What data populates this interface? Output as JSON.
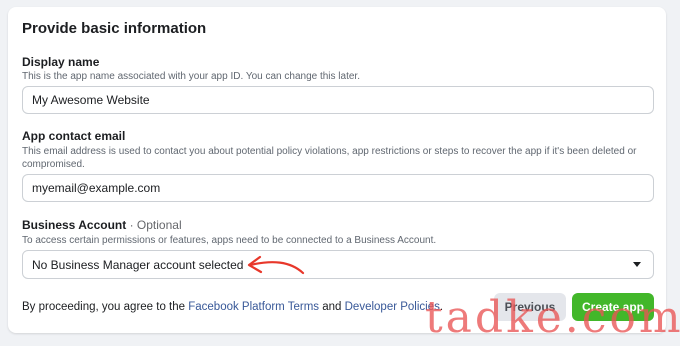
{
  "form": {
    "title": "Provide basic information",
    "display_name": {
      "label": "Display name",
      "help": "This is the app name associated with your app ID. You can change this later.",
      "value": "My Awesome Website"
    },
    "contact_email": {
      "label": "App contact email",
      "help": "This email address is used to contact you about potential policy violations, app restrictions or steps to recover the app if it's been deleted or compromised.",
      "value": "myemail@example.com"
    },
    "business_account": {
      "label": "Business Account",
      "optional": " · Optional",
      "help": "To access certain permissions or features, apps need to be connected to a Business Account.",
      "selected": "No Business Manager account selected"
    }
  },
  "footer": {
    "prefix": "By proceeding, you agree to the ",
    "terms_link": "Facebook Platform Terms",
    "and": " and ",
    "policies_link": "Developer Policies",
    "suffix": ".",
    "previous_label": "Previous",
    "create_label": "Create app"
  },
  "watermark": "tadke.com",
  "colors": {
    "create_button": "#42b72a",
    "link": "#385898",
    "annotation_arrow": "#e8372a"
  },
  "icons": {
    "dropdown": "chevron-down-icon",
    "annotation": "red-arrow-annotation"
  }
}
